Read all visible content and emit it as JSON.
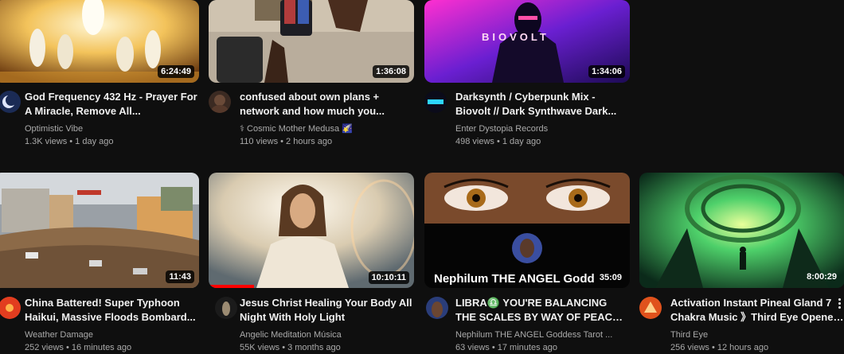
{
  "rows": [
    [
      {
        "title": "God Frequency 432 Hz - Prayer For A Miracle, Remove All...",
        "channel": "Optimistic Vibe",
        "stats": "1.3K views • 1 day ago",
        "duration": "6:24:49"
      },
      {
        "title": "confused about own plans + network and how much you...",
        "channel": "⚕ Cosmic Mother Medusa 🌠",
        "stats": "110 views • 2 hours ago",
        "duration": "1:36:08"
      },
      {
        "title": "Darksynth / Cyberpunk Mix - Biovolt // Dark Synthwave Dark...",
        "channel": "Enter Dystopia Records",
        "stats": "498 views • 1 day ago",
        "duration": "1:34:06",
        "thumb_text": "BIOVOLT"
      }
    ],
    [
      {
        "title": "China Battered! Super Typhoon Haikui, Massive Floods Bombard...",
        "channel": "Weather Damage",
        "stats": "252 views • 16 minutes ago",
        "duration": "11:43"
      },
      {
        "title": "Jesus Christ Healing Your Body All Night With Holy Light",
        "channel": "Angelic Meditation Música",
        "stats": "55K views • 3 months ago",
        "duration": "10:10:11",
        "progress": 0.22
      },
      {
        "title": "LIBRA♎ YOU'RE BALANCING THE SCALES BY WAY OF PEACE &...",
        "channel": "Nephilum THE ANGEL Goddess Tarot ...",
        "stats": "63 views • 17 minutes ago",
        "duration": "35:09",
        "thumb_text": "Nephilum THE ANGEL Godd"
      },
      {
        "title": "Activation Instant Pineal Gland 7 Chakra Music 》Third Eye Opener ...",
        "channel": "Third Eye",
        "stats": "256 views • 12 hours ago",
        "duration": "8:00:29"
      }
    ]
  ],
  "colors": {
    "background": "#0f0f0f",
    "progress": "#ff0000",
    "secondary_text": "#aaaaaa"
  }
}
